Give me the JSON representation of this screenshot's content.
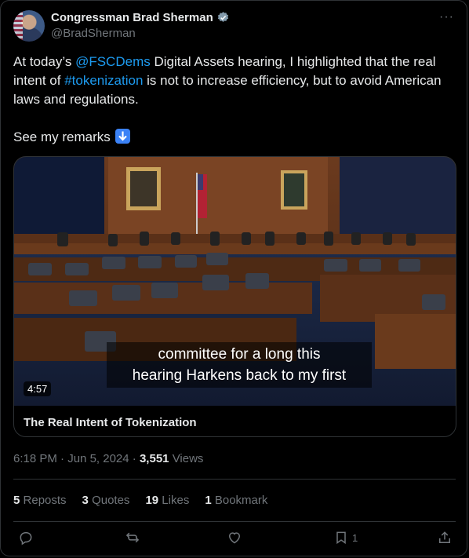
{
  "author": {
    "display_name": "Congressman Brad Sherman",
    "handle": "@BradSherman",
    "verified_color": "#829aab"
  },
  "tweet": {
    "text_1": "At today’s ",
    "mention": "@FSCDems",
    "text_2": " Digital Assets hearing, I highlighted that the real intent of ",
    "hashtag": "#tokenization",
    "text_3": " is not to increase efficiency, but to avoid American laws and regulations.",
    "line_2": "See my remarks"
  },
  "media": {
    "caption_line_1": "committee for a long this",
    "caption_line_2": "hearing Harkens back to my first",
    "duration": "4:57",
    "title": "The Real Intent of Tokenization"
  },
  "meta": {
    "time": "6:18 PM",
    "date": "Jun 5, 2024",
    "views_count": "3,551",
    "views_label": "Views"
  },
  "stats": {
    "reposts_count": "5",
    "reposts_label": "Reposts",
    "quotes_count": "3",
    "quotes_label": "Quotes",
    "likes_count": "19",
    "likes_label": "Likes",
    "bookmarks_count": "1",
    "bookmarks_label": "Bookmark"
  },
  "actions": {
    "bookmark_count": "1"
  },
  "colors": {
    "accent": "#1d9bf0",
    "muted": "#71767b",
    "text": "#e7e9ea",
    "border": "#2f3336"
  },
  "icons": [
    "verified-badge-icon",
    "more-icon",
    "down-arrow-emoji-icon",
    "reply-icon",
    "repost-icon",
    "like-icon",
    "bookmark-icon",
    "share-icon"
  ]
}
